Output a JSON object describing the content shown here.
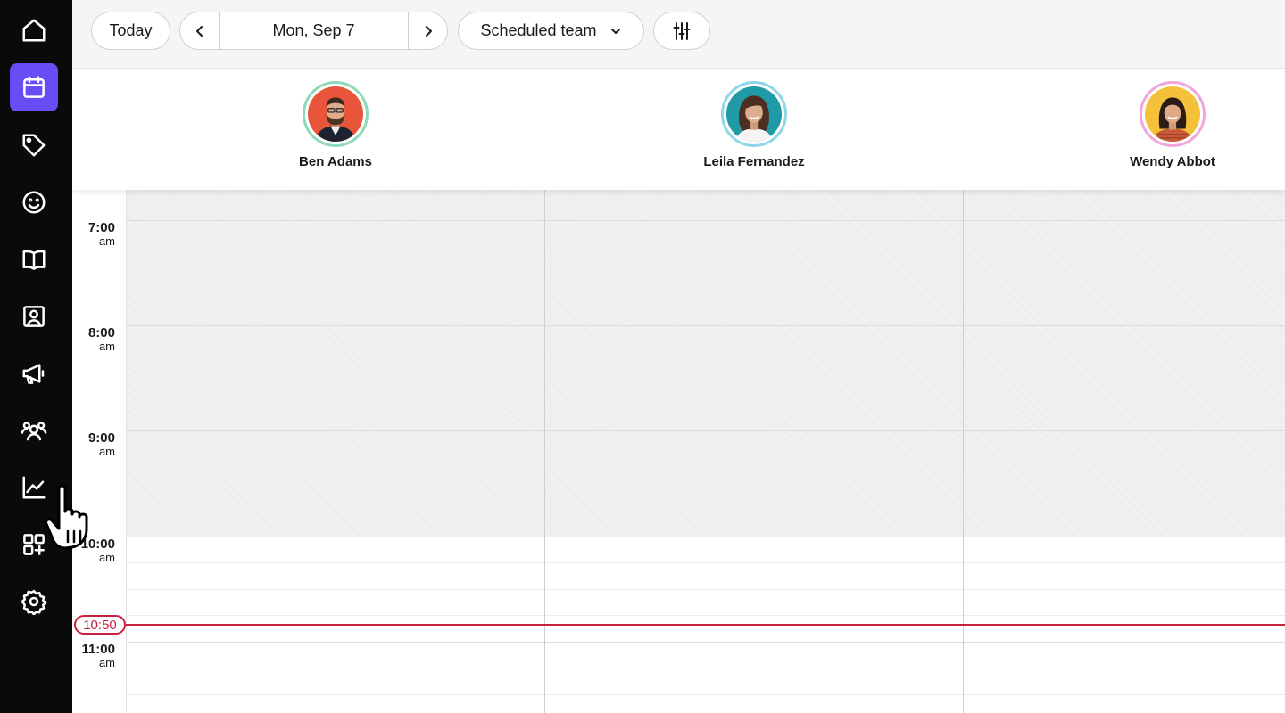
{
  "toolbar": {
    "today_label": "Today",
    "date_label": "Mon, Sep 7",
    "team_label": "Scheduled team"
  },
  "sidebar": {
    "items": [
      {
        "name": "home",
        "icon": "home-icon",
        "active": false
      },
      {
        "name": "calendar",
        "icon": "calendar-icon",
        "active": true
      },
      {
        "name": "sales",
        "icon": "tag-icon",
        "active": false
      },
      {
        "name": "clients",
        "icon": "smile-icon",
        "active": false
      },
      {
        "name": "catalog",
        "icon": "book-icon",
        "active": false
      },
      {
        "name": "contacts",
        "icon": "contact-card-icon",
        "active": false
      },
      {
        "name": "marketing",
        "icon": "megaphone-icon",
        "active": false
      },
      {
        "name": "team",
        "icon": "team-icon",
        "active": false
      },
      {
        "name": "reports",
        "icon": "chart-icon",
        "active": false
      },
      {
        "name": "add-ons",
        "icon": "apps-add-icon",
        "active": false
      },
      {
        "name": "settings",
        "icon": "gear-icon",
        "active": false
      }
    ]
  },
  "staff": [
    {
      "name": "Ben Adams",
      "ring_color": "#8fd9b6",
      "bg_color": "#e8553a"
    },
    {
      "name": "Leila Fernandez",
      "ring_color": "#8fd6e8",
      "bg_color": "#1f9aa6"
    },
    {
      "name": "Wendy Abbot",
      "ring_color": "#f0a6d8",
      "bg_color": "#f5c03a"
    }
  ],
  "times": [
    {
      "time": "7:00",
      "period": "am"
    },
    {
      "time": "8:00",
      "period": "am"
    },
    {
      "time": "9:00",
      "period": "am"
    },
    {
      "time": "10:00",
      "period": "am"
    },
    {
      "time": "11:00",
      "period": "am"
    }
  ],
  "current_time": "10:50",
  "colors": {
    "accent": "#6a4cf5",
    "now_line": "#c8203f",
    "sidebar_bg": "#0a0a0a"
  }
}
